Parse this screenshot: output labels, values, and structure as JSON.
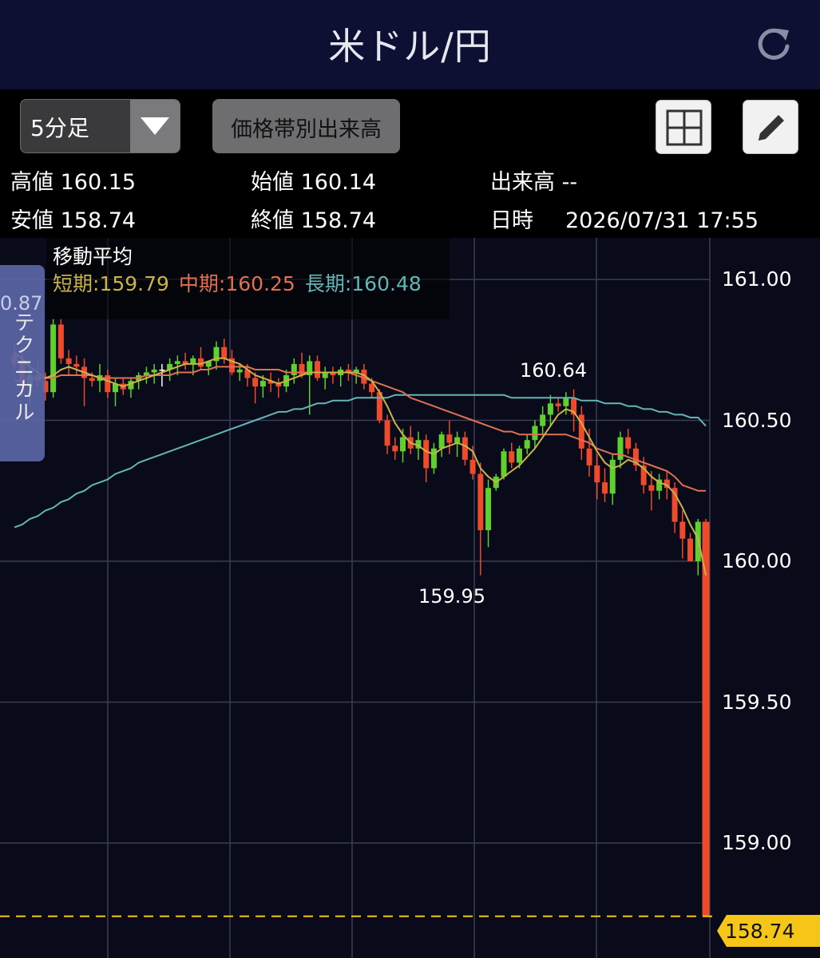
{
  "header": {
    "title": "米ドル/円",
    "refresh_icon": "refresh-icon"
  },
  "toolbar": {
    "timeframe": "5分足",
    "volume_by_price_label": "価格帯別出来高",
    "layout_icon": "grid-icon",
    "draw_icon": "pencil-icon"
  },
  "ohlc": {
    "high_label": "高値",
    "high": "160.15",
    "open_label": "始値",
    "open": "160.14",
    "volume_label": "出来高",
    "volume": "--",
    "low_label": "安値",
    "low": "158.74",
    "close_label": "終値",
    "close": "158.74",
    "datetime_label": "日時",
    "datetime": "2026/07/31 17:55"
  },
  "moving_average": {
    "title": "移動平均",
    "short_label": "短期:",
    "short": "159.79",
    "mid_label": "中期:",
    "mid": "160.25",
    "long_label": "長期:",
    "long": "160.48"
  },
  "technical_tab": {
    "value": "0.87",
    "label": "テクニカル"
  },
  "colors": {
    "up": "#5fd02e",
    "down": "#ef4a2b",
    "short_ma": "#c8b44a",
    "mid_ma": "#e07050",
    "long_ma": "#62b6b6",
    "current_price": "#f5c518"
  },
  "chart_data": {
    "type": "candlestick",
    "y_ticks": [
      "161.00",
      "160.50",
      "160.00",
      "159.50",
      "159.00"
    ],
    "ylim": [
      158.7,
      161.13
    ],
    "annotations": [
      {
        "label": "160.64",
        "value": 160.64
      },
      {
        "label": "159.95",
        "value": 159.95
      }
    ],
    "current_price": {
      "label": "158.74",
      "value": 158.74
    },
    "candles": [
      [
        160.73,
        160.77,
        160.68,
        160.7
      ],
      [
        160.71,
        160.74,
        160.58,
        160.62
      ],
      [
        160.62,
        160.68,
        160.55,
        160.66
      ],
      [
        160.66,
        160.71,
        160.62,
        160.64
      ],
      [
        160.64,
        160.67,
        160.57,
        160.6
      ],
      [
        160.6,
        160.86,
        160.58,
        160.84
      ],
      [
        160.84,
        160.86,
        160.7,
        160.72
      ],
      [
        160.72,
        160.75,
        160.66,
        160.7
      ],
      [
        160.7,
        160.73,
        160.66,
        160.69
      ],
      [
        160.69,
        160.72,
        160.55,
        160.65
      ],
      [
        160.65,
        160.67,
        160.62,
        160.64
      ],
      [
        160.64,
        160.7,
        160.6,
        160.66
      ],
      [
        160.66,
        160.68,
        160.58,
        160.6
      ],
      [
        160.6,
        160.65,
        160.55,
        160.63
      ],
      [
        160.63,
        160.65,
        160.59,
        160.61
      ],
      [
        160.61,
        160.65,
        160.58,
        160.64
      ],
      [
        160.64,
        160.67,
        160.61,
        160.66
      ],
      [
        160.66,
        160.69,
        160.63,
        160.67
      ],
      [
        160.67,
        160.7,
        160.63,
        160.68
      ],
      [
        160.68,
        160.7,
        160.62,
        160.68
      ],
      [
        160.68,
        160.72,
        160.64,
        160.7
      ],
      [
        160.7,
        160.73,
        160.66,
        160.71
      ],
      [
        160.71,
        160.74,
        160.68,
        160.7
      ],
      [
        160.7,
        160.73,
        160.66,
        160.72
      ],
      [
        160.72,
        160.76,
        160.68,
        160.69
      ],
      [
        160.69,
        160.71,
        160.66,
        160.71
      ],
      [
        160.71,
        160.78,
        160.68,
        160.76
      ],
      [
        160.76,
        160.79,
        160.7,
        160.72
      ],
      [
        160.72,
        160.75,
        160.66,
        160.67
      ],
      [
        160.67,
        160.7,
        160.64,
        160.68
      ],
      [
        160.68,
        160.7,
        160.62,
        160.65
      ],
      [
        160.65,
        160.67,
        160.56,
        160.62
      ],
      [
        160.62,
        160.66,
        160.58,
        160.64
      ],
      [
        160.64,
        160.67,
        160.6,
        160.63
      ],
      [
        160.63,
        160.65,
        160.58,
        160.62
      ],
      [
        160.62,
        160.68,
        160.6,
        160.66
      ],
      [
        160.66,
        160.72,
        160.63,
        160.7
      ],
      [
        160.7,
        160.74,
        160.65,
        160.66
      ],
      [
        160.66,
        160.73,
        160.52,
        160.71
      ],
      [
        160.71,
        160.73,
        160.64,
        160.65
      ],
      [
        160.65,
        160.69,
        160.61,
        160.67
      ],
      [
        160.67,
        160.69,
        160.63,
        160.66
      ],
      [
        160.66,
        160.69,
        160.62,
        160.68
      ],
      [
        160.68,
        160.7,
        160.64,
        160.67
      ],
      [
        160.67,
        160.69,
        160.63,
        160.68
      ],
      [
        160.68,
        160.7,
        160.61,
        160.63
      ],
      [
        160.63,
        160.65,
        160.58,
        160.6
      ],
      [
        160.6,
        160.61,
        160.49,
        160.5
      ],
      [
        160.5,
        160.52,
        160.38,
        160.41
      ],
      [
        160.41,
        160.44,
        160.36,
        160.39
      ],
      [
        160.39,
        160.47,
        160.35,
        160.44
      ],
      [
        160.44,
        160.48,
        160.38,
        160.4
      ],
      [
        160.4,
        160.46,
        160.36,
        160.43
      ],
      [
        160.43,
        160.45,
        160.28,
        160.33
      ],
      [
        160.33,
        160.42,
        160.31,
        160.4
      ],
      [
        160.4,
        160.46,
        160.37,
        160.45
      ],
      [
        160.45,
        160.5,
        160.38,
        160.42
      ],
      [
        160.42,
        160.46,
        160.37,
        160.44
      ],
      [
        160.44,
        160.46,
        160.34,
        160.36
      ],
      [
        160.36,
        160.41,
        160.29,
        160.31
      ],
      [
        160.31,
        160.35,
        159.95,
        160.11
      ],
      [
        160.11,
        160.29,
        160.05,
        160.26
      ],
      [
        160.26,
        160.31,
        160.25,
        160.3
      ],
      [
        160.3,
        160.4,
        160.29,
        160.39
      ],
      [
        160.39,
        160.42,
        160.33,
        160.35
      ],
      [
        160.35,
        160.41,
        160.33,
        160.4
      ],
      [
        160.4,
        160.45,
        160.38,
        160.43
      ],
      [
        160.43,
        160.5,
        160.4,
        160.48
      ],
      [
        160.48,
        160.55,
        160.45,
        160.52
      ],
      [
        160.52,
        160.59,
        160.48,
        160.56
      ],
      [
        160.56,
        160.58,
        160.53,
        160.55
      ],
      [
        160.55,
        160.6,
        160.52,
        160.58
      ],
      [
        160.58,
        160.61,
        160.46,
        160.52
      ],
      [
        160.52,
        160.55,
        160.36,
        160.4
      ],
      [
        160.4,
        160.47,
        160.3,
        160.34
      ],
      [
        160.34,
        160.38,
        160.22,
        160.28
      ],
      [
        160.28,
        160.33,
        160.21,
        160.24
      ],
      [
        160.24,
        160.38,
        160.2,
        160.36
      ],
      [
        160.36,
        160.46,
        160.33,
        160.44
      ],
      [
        160.44,
        160.47,
        160.38,
        160.4
      ],
      [
        160.4,
        160.42,
        160.32,
        160.34
      ],
      [
        160.34,
        160.37,
        160.24,
        160.27
      ],
      [
        160.27,
        160.32,
        160.18,
        160.25
      ],
      [
        160.25,
        160.31,
        160.22,
        160.29
      ],
      [
        160.29,
        160.32,
        160.22,
        160.26
      ],
      [
        160.26,
        160.28,
        160.1,
        160.14
      ],
      [
        160.14,
        160.18,
        160.01,
        160.08
      ],
      [
        160.08,
        160.1,
        160.05,
        160.0
      ],
      [
        160.0,
        160.15,
        159.95,
        160.14
      ],
      [
        160.14,
        160.15,
        158.74,
        158.74
      ]
    ],
    "ma_short": [
      160.74,
      160.72,
      160.69,
      160.67,
      160.65,
      160.66,
      160.68,
      160.69,
      160.68,
      160.67,
      160.66,
      160.65,
      160.64,
      160.63,
      160.62,
      160.63,
      160.64,
      160.65,
      160.66,
      160.67,
      160.68,
      160.69,
      160.7,
      160.7,
      160.7,
      160.71,
      160.72,
      160.72,
      160.71,
      160.7,
      160.68,
      160.66,
      160.65,
      160.64,
      160.63,
      160.64,
      160.65,
      160.66,
      160.67,
      160.67,
      160.67,
      160.67,
      160.67,
      160.67,
      160.67,
      160.66,
      160.64,
      160.6,
      160.55,
      160.49,
      160.45,
      160.42,
      160.41,
      160.39,
      160.38,
      160.4,
      160.41,
      160.42,
      160.41,
      160.39,
      160.33,
      160.3,
      160.28,
      160.3,
      160.32,
      160.34,
      160.37,
      160.4,
      160.44,
      160.48,
      160.52,
      160.54,
      160.53,
      160.49,
      160.44,
      160.39,
      160.35,
      160.33,
      160.34,
      160.36,
      160.35,
      160.33,
      160.3,
      160.28,
      160.27,
      160.24,
      160.19,
      160.13,
      160.08,
      159.95
    ],
    "ma_mid": [
      160.64,
      160.64,
      160.65,
      160.65,
      160.65,
      160.65,
      160.66,
      160.66,
      160.66,
      160.66,
      160.66,
      160.65,
      160.65,
      160.65,
      160.65,
      160.65,
      160.65,
      160.66,
      160.66,
      160.66,
      160.66,
      160.67,
      160.67,
      160.67,
      160.68,
      160.68,
      160.69,
      160.69,
      160.69,
      160.69,
      160.69,
      160.68,
      160.68,
      160.68,
      160.68,
      160.67,
      160.67,
      160.67,
      160.67,
      160.67,
      160.67,
      160.67,
      160.67,
      160.67,
      160.66,
      160.65,
      160.64,
      160.63,
      160.62,
      160.61,
      160.6,
      160.58,
      160.57,
      160.56,
      160.55,
      160.54,
      160.53,
      160.52,
      160.51,
      160.5,
      160.49,
      160.48,
      160.47,
      160.46,
      160.46,
      160.45,
      160.45,
      160.45,
      160.45,
      160.45,
      160.45,
      160.45,
      160.44,
      160.43,
      160.42,
      160.4,
      160.39,
      160.38,
      160.38,
      160.37,
      160.36,
      160.35,
      160.34,
      160.33,
      160.32,
      160.3,
      160.27,
      160.26,
      160.25,
      160.25
    ],
    "ma_long": [
      160.12,
      160.13,
      160.15,
      160.16,
      160.18,
      160.19,
      160.21,
      160.22,
      160.24,
      160.25,
      160.27,
      160.28,
      160.29,
      160.31,
      160.32,
      160.33,
      160.35,
      160.36,
      160.37,
      160.38,
      160.39,
      160.4,
      160.41,
      160.42,
      160.43,
      160.44,
      160.45,
      160.46,
      160.47,
      160.48,
      160.49,
      160.5,
      160.51,
      160.52,
      160.53,
      160.53,
      160.54,
      160.54,
      160.55,
      160.56,
      160.56,
      160.57,
      160.57,
      160.57,
      160.58,
      160.58,
      160.58,
      160.58,
      160.58,
      160.59,
      160.59,
      160.59,
      160.59,
      160.59,
      160.59,
      160.59,
      160.59,
      160.59,
      160.59,
      160.59,
      160.59,
      160.59,
      160.59,
      160.59,
      160.58,
      160.58,
      160.58,
      160.58,
      160.58,
      160.58,
      160.58,
      160.58,
      160.58,
      160.57,
      160.57,
      160.57,
      160.56,
      160.56,
      160.56,
      160.55,
      160.55,
      160.54,
      160.54,
      160.53,
      160.53,
      160.52,
      160.52,
      160.51,
      160.51,
      160.48
    ]
  }
}
